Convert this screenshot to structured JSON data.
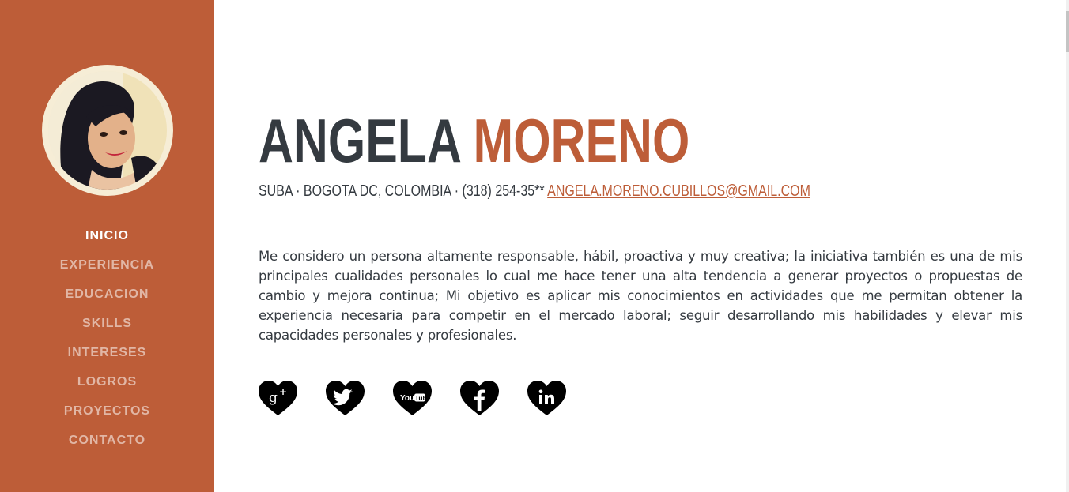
{
  "profile": {
    "photo_alt": "Profile photo"
  },
  "nav": {
    "items": [
      {
        "label": "INICIO",
        "active": true
      },
      {
        "label": "EXPERIENCIA",
        "active": false
      },
      {
        "label": "EDUCACION",
        "active": false
      },
      {
        "label": "SKILLS",
        "active": false
      },
      {
        "label": "INTERESES",
        "active": false
      },
      {
        "label": "LOGROS",
        "active": false
      },
      {
        "label": "PROYECTOS",
        "active": false
      },
      {
        "label": "CONTACTO",
        "active": false
      }
    ]
  },
  "header": {
    "first_name": "ANGELA",
    "last_name": "MORENO",
    "address": "SUBA · BOGOTA DC, COLOMBIA · (318) 254-35**",
    "email": "ANGELA.MORENO.CUBILLOS@GMAIL.COM"
  },
  "about": {
    "text": "Me considero un persona altamente responsable, hábil, proactiva y muy creativa; la iniciativa también es una de mis principales cualidades personales lo cual me hace tener una alta tendencia a generar proyectos o propuestas de cambio y mejora continua; Mi objetivo es aplicar mis conocimientos en actividades que me permitan obtener la experiencia necesaria para competir en el mercado laboral; seguir desarrollando mis habilidades y elevar mis capacidades personales y profesionales."
  },
  "social": {
    "icons": [
      {
        "name": "google-plus-icon",
        "glyph": "g+"
      },
      {
        "name": "twitter-icon",
        "glyph": "twitter"
      },
      {
        "name": "youtube-icon",
        "glyph": "YouTube"
      },
      {
        "name": "facebook-icon",
        "glyph": "f"
      },
      {
        "name": "linkedin-icon",
        "glyph": "in"
      }
    ]
  },
  "colors": {
    "accent": "#bd5d38",
    "text": "#343a40",
    "icon": "#000000"
  }
}
